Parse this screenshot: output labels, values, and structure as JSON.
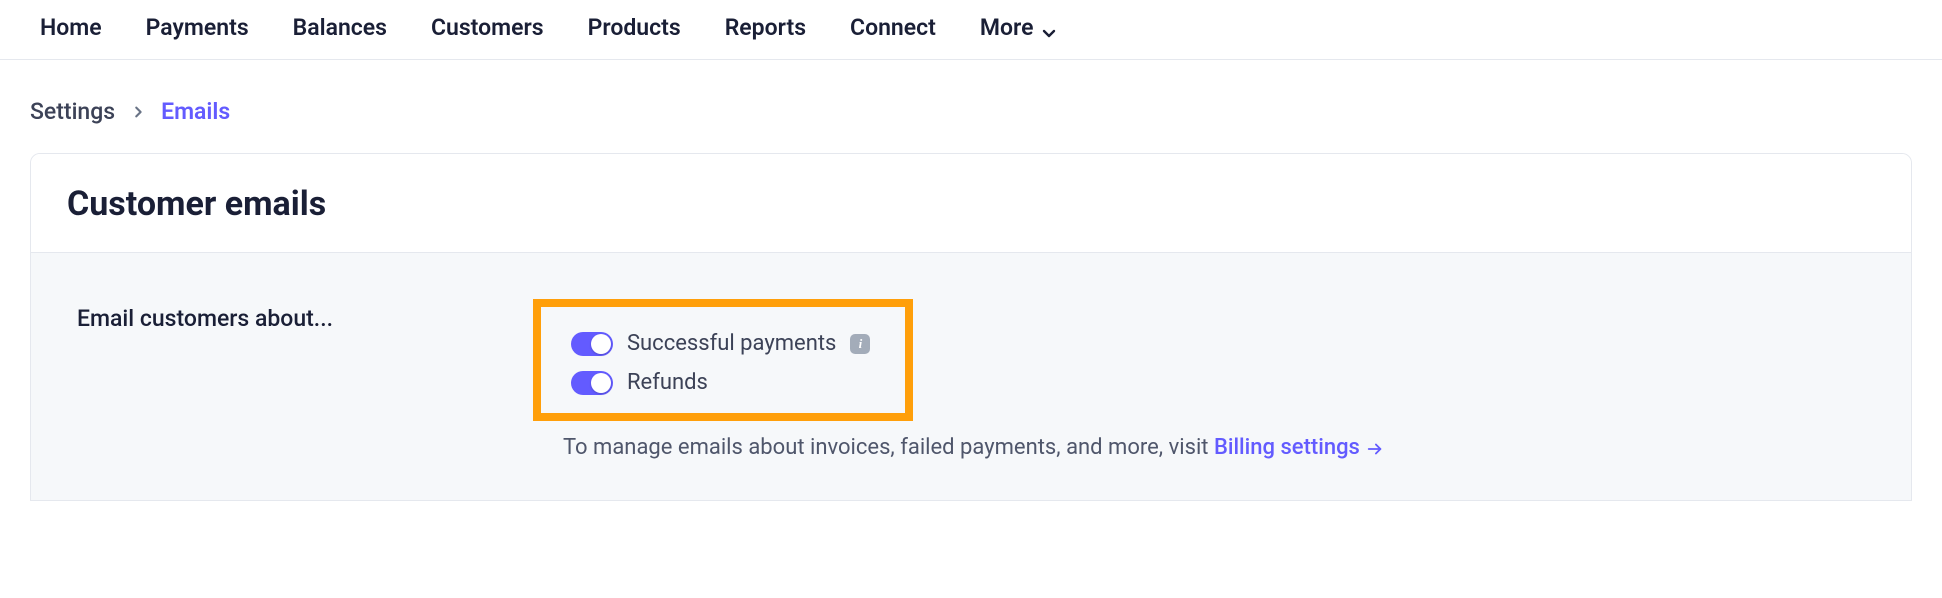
{
  "nav": {
    "items": [
      "Home",
      "Payments",
      "Balances",
      "Customers",
      "Products",
      "Reports",
      "Connect"
    ],
    "more_label": "More"
  },
  "breadcrumb": {
    "root": "Settings",
    "current": "Emails"
  },
  "panel": {
    "title": "Customer emails",
    "section_label": "Email customers about...",
    "toggles": [
      {
        "label": "Successful payments",
        "on": true,
        "has_info": true
      },
      {
        "label": "Refunds",
        "on": true,
        "has_info": false
      }
    ],
    "help": {
      "prefix": "To manage emails about invoices, failed payments, and more, visit ",
      "link_label": "Billing settings"
    },
    "info_glyph": "i"
  }
}
